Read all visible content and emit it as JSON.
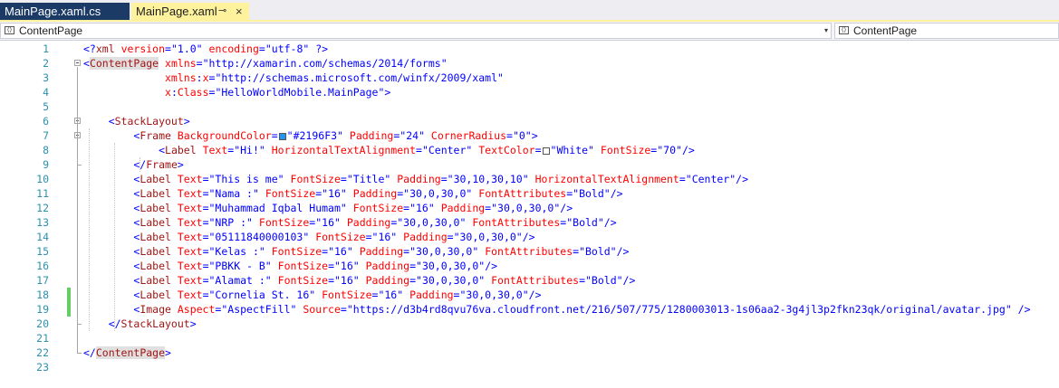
{
  "tabs": [
    {
      "label": "MainPage.xaml.cs",
      "active": false
    },
    {
      "label": "MainPage.xaml",
      "active": true,
      "pin_glyph": "⊸",
      "close_glyph": "×"
    }
  ],
  "navbar": {
    "left_combo": "ContentPage",
    "right_combo": "ContentPage",
    "dropdown_glyph": "▾"
  },
  "colors": {
    "tab_active": "#FFF29D",
    "tab_inactive": "#1B3A66",
    "line_number": "#2B91AF",
    "element": "#A31515",
    "attribute": "#FF0000",
    "value": "#0000FF",
    "change_marker": "#66CC66",
    "swatch_blue": "#2196F3",
    "swatch_white": "#FFFFFF"
  },
  "lines": [
    {
      "n": "1",
      "segs": [
        [
          "p",
          "<?"
        ],
        [
          "k",
          "xml"
        ],
        [
          "a",
          " version"
        ],
        [
          "p",
          "="
        ],
        [
          "v",
          "\"1.0\""
        ],
        [
          "a",
          " encoding"
        ],
        [
          "p",
          "="
        ],
        [
          "v",
          "\"utf-8\""
        ],
        [
          "p",
          " ?>"
        ]
      ]
    },
    {
      "n": "2",
      "segs": [
        [
          "p",
          "<"
        ],
        [
          "k",
          "ContentPage"
        ],
        [
          "a",
          " xmlns"
        ],
        [
          "p",
          "="
        ],
        [
          "v",
          "\"http://xamarin.com/schemas/2014/forms\""
        ]
      ]
    },
    {
      "n": "3",
      "segs": [
        [
          "a",
          "             xmlns"
        ],
        [
          "p",
          ":"
        ],
        [
          "a",
          "x"
        ],
        [
          "p",
          "="
        ],
        [
          "v",
          "\"http://schemas.microsoft.com/winfx/2009/xaml\""
        ]
      ]
    },
    {
      "n": "4",
      "segs": [
        [
          "a",
          "             x"
        ],
        [
          "p",
          ":"
        ],
        [
          "a",
          "Class"
        ],
        [
          "p",
          "="
        ],
        [
          "v",
          "\"HelloWorldMobile.MainPage\""
        ],
        [
          "p",
          ">"
        ]
      ]
    },
    {
      "n": "5",
      "segs": []
    },
    {
      "n": "6",
      "segs": [
        [
          "p",
          "    <"
        ],
        [
          "k",
          "StackLayout"
        ],
        [
          "p",
          ">"
        ]
      ]
    },
    {
      "n": "7",
      "segs": [
        [
          "p",
          "        <"
        ],
        [
          "k",
          "Frame"
        ],
        [
          "a",
          " BackgroundColor"
        ],
        [
          "p",
          "="
        ],
        [
          "sw",
          "#2196F3"
        ],
        [
          "v",
          "\"#2196F3\""
        ],
        [
          "a",
          " Padding"
        ],
        [
          "p",
          "="
        ],
        [
          "v",
          "\"24\""
        ],
        [
          "a",
          " CornerRadius"
        ],
        [
          "p",
          "="
        ],
        [
          "v",
          "\"0\""
        ],
        [
          "p",
          ">"
        ]
      ]
    },
    {
      "n": "8",
      "segs": [
        [
          "p",
          "            <"
        ],
        [
          "k",
          "Label"
        ],
        [
          "a",
          " Text"
        ],
        [
          "p",
          "="
        ],
        [
          "v",
          "\"Hi!\""
        ],
        [
          "a",
          " HorizontalTextAlignment"
        ],
        [
          "p",
          "="
        ],
        [
          "v",
          "\"Center\""
        ],
        [
          "a",
          " TextColor"
        ],
        [
          "p",
          "="
        ],
        [
          "sw",
          "#FFFFFF"
        ],
        [
          "v",
          "\"White\""
        ],
        [
          "a",
          " FontSize"
        ],
        [
          "p",
          "="
        ],
        [
          "v",
          "\"70\""
        ],
        [
          "p",
          "/>"
        ]
      ]
    },
    {
      "n": "9",
      "segs": [
        [
          "p",
          "        </"
        ],
        [
          "k",
          "Frame"
        ],
        [
          "p",
          ">"
        ]
      ]
    },
    {
      "n": "10",
      "segs": [
        [
          "p",
          "        <"
        ],
        [
          "k",
          "Label"
        ],
        [
          "a",
          " Text"
        ],
        [
          "p",
          "="
        ],
        [
          "v",
          "\"This is me\""
        ],
        [
          "a",
          " FontSize"
        ],
        [
          "p",
          "="
        ],
        [
          "v",
          "\"Title\""
        ],
        [
          "a",
          " Padding"
        ],
        [
          "p",
          "="
        ],
        [
          "v",
          "\"30,10,30,10\""
        ],
        [
          "a",
          " HorizontalTextAlignment"
        ],
        [
          "p",
          "="
        ],
        [
          "v",
          "\"Center\""
        ],
        [
          "p",
          "/>"
        ]
      ]
    },
    {
      "n": "11",
      "segs": [
        [
          "p",
          "        <"
        ],
        [
          "k",
          "Label"
        ],
        [
          "a",
          " Text"
        ],
        [
          "p",
          "="
        ],
        [
          "v",
          "\"Nama :\""
        ],
        [
          "a",
          " FontSize"
        ],
        [
          "p",
          "="
        ],
        [
          "v",
          "\"16\""
        ],
        [
          "a",
          " Padding"
        ],
        [
          "p",
          "="
        ],
        [
          "v",
          "\"30,0,30,0\""
        ],
        [
          "a",
          " FontAttributes"
        ],
        [
          "p",
          "="
        ],
        [
          "v",
          "\"Bold\""
        ],
        [
          "p",
          "/>"
        ]
      ]
    },
    {
      "n": "12",
      "segs": [
        [
          "p",
          "        <"
        ],
        [
          "k",
          "Label"
        ],
        [
          "a",
          " Text"
        ],
        [
          "p",
          "="
        ],
        [
          "v",
          "\"Muhammad Iqbal Humam\""
        ],
        [
          "a",
          " FontSize"
        ],
        [
          "p",
          "="
        ],
        [
          "v",
          "\"16\""
        ],
        [
          "a",
          " Padding"
        ],
        [
          "p",
          "="
        ],
        [
          "v",
          "\"30,0,30,0\""
        ],
        [
          "p",
          "/>"
        ]
      ]
    },
    {
      "n": "13",
      "segs": [
        [
          "p",
          "        <"
        ],
        [
          "k",
          "Label"
        ],
        [
          "a",
          " Text"
        ],
        [
          "p",
          "="
        ],
        [
          "v",
          "\"NRP :\""
        ],
        [
          "a",
          " FontSize"
        ],
        [
          "p",
          "="
        ],
        [
          "v",
          "\"16\""
        ],
        [
          "a",
          " Padding"
        ],
        [
          "p",
          "="
        ],
        [
          "v",
          "\"30,0,30,0\""
        ],
        [
          "a",
          " FontAttributes"
        ],
        [
          "p",
          "="
        ],
        [
          "v",
          "\"Bold\""
        ],
        [
          "p",
          "/>"
        ]
      ]
    },
    {
      "n": "14",
      "segs": [
        [
          "p",
          "        <"
        ],
        [
          "k",
          "Label"
        ],
        [
          "a",
          " Text"
        ],
        [
          "p",
          "="
        ],
        [
          "v",
          "\"05111840000103\""
        ],
        [
          "a",
          " FontSize"
        ],
        [
          "p",
          "="
        ],
        [
          "v",
          "\"16\""
        ],
        [
          "a",
          " Padding"
        ],
        [
          "p",
          "="
        ],
        [
          "v",
          "\"30,0,30,0\""
        ],
        [
          "p",
          "/>"
        ]
      ]
    },
    {
      "n": "15",
      "segs": [
        [
          "p",
          "        <"
        ],
        [
          "k",
          "Label"
        ],
        [
          "a",
          " Text"
        ],
        [
          "p",
          "="
        ],
        [
          "v",
          "\"Kelas :\""
        ],
        [
          "a",
          " FontSize"
        ],
        [
          "p",
          "="
        ],
        [
          "v",
          "\"16\""
        ],
        [
          "a",
          " Padding"
        ],
        [
          "p",
          "="
        ],
        [
          "v",
          "\"30,0,30,0\""
        ],
        [
          "a",
          " FontAttributes"
        ],
        [
          "p",
          "="
        ],
        [
          "v",
          "\"Bold\""
        ],
        [
          "p",
          "/>"
        ]
      ]
    },
    {
      "n": "16",
      "segs": [
        [
          "p",
          "        <"
        ],
        [
          "k",
          "Label"
        ],
        [
          "a",
          " Text"
        ],
        [
          "p",
          "="
        ],
        [
          "v",
          "\"PBKK - B\""
        ],
        [
          "a",
          " FontSize"
        ],
        [
          "p",
          "="
        ],
        [
          "v",
          "\"16\""
        ],
        [
          "a",
          " Padding"
        ],
        [
          "p",
          "="
        ],
        [
          "v",
          "\"30,0,30,0\""
        ],
        [
          "p",
          "/>"
        ]
      ]
    },
    {
      "n": "17",
      "segs": [
        [
          "p",
          "        <"
        ],
        [
          "k",
          "Label"
        ],
        [
          "a",
          " Text"
        ],
        [
          "p",
          "="
        ],
        [
          "v",
          "\"Alamat :\""
        ],
        [
          "a",
          " FontSize"
        ],
        [
          "p",
          "="
        ],
        [
          "v",
          "\"16\""
        ],
        [
          "a",
          " Padding"
        ],
        [
          "p",
          "="
        ],
        [
          "v",
          "\"30,0,30,0\""
        ],
        [
          "a",
          " FontAttributes"
        ],
        [
          "p",
          "="
        ],
        [
          "v",
          "\"Bold\""
        ],
        [
          "p",
          "/>"
        ]
      ]
    },
    {
      "n": "18",
      "segs": [
        [
          "p",
          "        <"
        ],
        [
          "k",
          "Label"
        ],
        [
          "a",
          " Text"
        ],
        [
          "p",
          "="
        ],
        [
          "v",
          "\"Cornelia St. 16\""
        ],
        [
          "a",
          " FontSize"
        ],
        [
          "p",
          "="
        ],
        [
          "v",
          "\"16\""
        ],
        [
          "a",
          " Padding"
        ],
        [
          "p",
          "="
        ],
        [
          "v",
          "\"30,0,30,0\""
        ],
        [
          "p",
          "/>"
        ]
      ]
    },
    {
      "n": "19",
      "segs": [
        [
          "p",
          "        <"
        ],
        [
          "k",
          "Image"
        ],
        [
          "a",
          " Aspect"
        ],
        [
          "p",
          "="
        ],
        [
          "v",
          "\"AspectFill\""
        ],
        [
          "a",
          " Source"
        ],
        [
          "p",
          "="
        ],
        [
          "v",
          "\"https://d3b4rd8qvu76va.cloudfront.net/216/507/775/1280003013-1s06aa2-3g4jl3p2fkn23qk/original/avatar.jpg\""
        ],
        [
          "p",
          " />"
        ]
      ]
    },
    {
      "n": "20",
      "segs": [
        [
          "p",
          "    </"
        ],
        [
          "k",
          "StackLayout"
        ],
        [
          "p",
          ">"
        ]
      ]
    },
    {
      "n": "21",
      "segs": []
    },
    {
      "n": "22",
      "segs": [
        [
          "p",
          "</"
        ],
        [
          "k",
          "ContentPage"
        ],
        [
          "p",
          ">"
        ]
      ]
    },
    {
      "n": "23",
      "segs": []
    }
  ]
}
